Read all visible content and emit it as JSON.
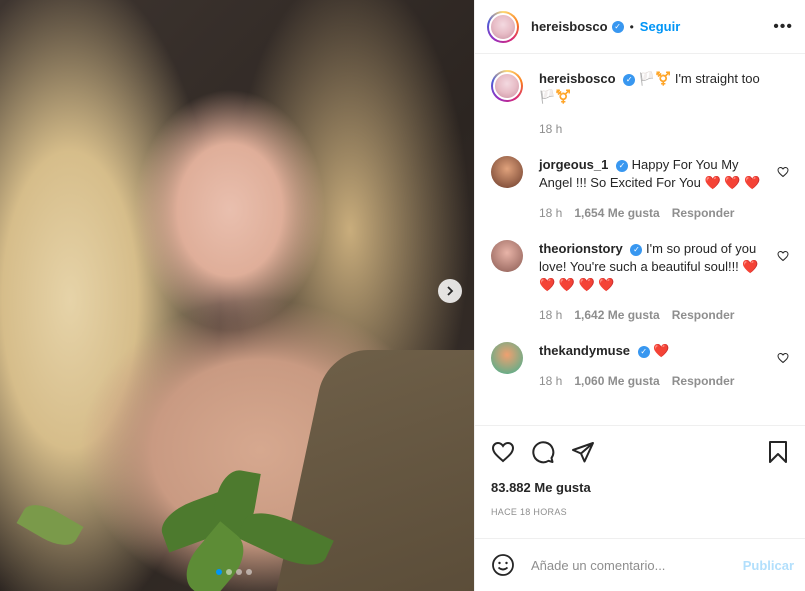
{
  "post": {
    "username": "hereisbosco",
    "follow_label": "Seguir",
    "bullet": "•",
    "more_label": "•••",
    "caption": "🏳️⚧️ I'm straight too🏳️⚧️",
    "caption_time": "18 h",
    "likes": "83.882 Me gusta",
    "time_ago": "HACE 18 HORAS"
  },
  "comments": [
    {
      "username": "jorgeous_1",
      "text": "Happy For You My Angel !!! So Excited For You ❤️ ❤️ ❤️",
      "time": "18 h",
      "likes": "1,654 Me gusta",
      "reply": "Responder",
      "avatar_color": "#b07a5a"
    },
    {
      "username": "theorionstory",
      "text": "I'm so proud of you love! You're such a beautiful soul!!! ❤️ ❤️ ❤️ ❤️ ❤️",
      "time": "18 h",
      "likes": "1,642 Me gusta",
      "reply": "Responder",
      "avatar_color": "#c4867a"
    },
    {
      "username": "thekandymuse",
      "text": "❤️",
      "time": "18 h",
      "likes": "1,060 Me gusta",
      "reply": "Responder",
      "avatar_color": "#5fbf9f"
    }
  ],
  "composer": {
    "placeholder": "Añade un comentario...",
    "publish_label": "Publicar"
  },
  "colors": {
    "accent": "#0095f6",
    "verified": "#3897f0"
  },
  "carousel": {
    "current": 1,
    "total": 4
  }
}
